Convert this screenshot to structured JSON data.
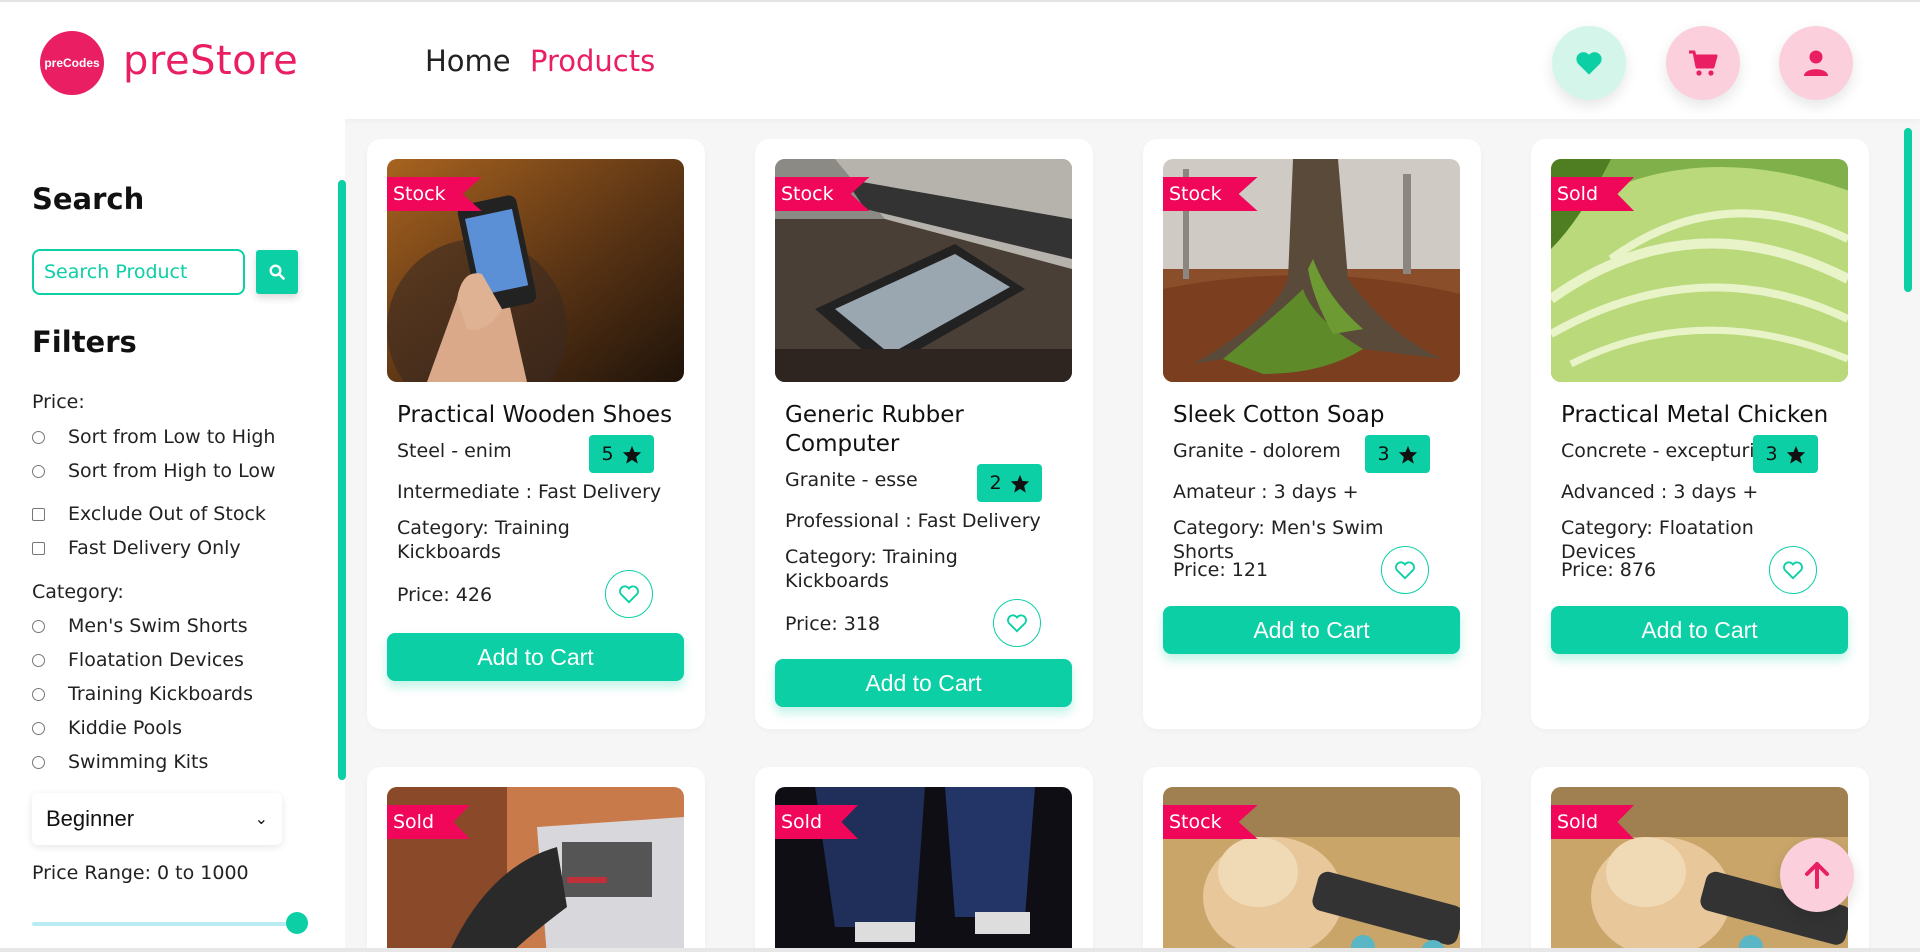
{
  "header": {
    "logo_text": "preCodes",
    "brand": "preStore",
    "nav": {
      "home": "Home",
      "products": "Products"
    },
    "icons": {
      "wishlist": "heart-icon",
      "cart": "cart-icon",
      "user": "user-icon"
    }
  },
  "sidebar": {
    "search_title": "Search",
    "search_placeholder": "Search Product",
    "filters_title": "Filters",
    "price_label": "Price:",
    "sort_low_high": "Sort from Low to High",
    "sort_high_low": "Sort from High to Low",
    "exclude_out_of_stock": "Exclude Out of Stock",
    "fast_delivery_only": "Fast Delivery Only",
    "category_label": "Category:",
    "categories": [
      "Men's Swim Shorts",
      "Floatation Devices",
      "Training Kickboards",
      "Kiddie Pools",
      "Swimming Kits"
    ],
    "level_selected": "Beginner",
    "price_range_label": "Price Range: 0 to 1000",
    "price_range_value": 1000
  },
  "products": [
    {
      "badge": "Stock",
      "name": "Practical Wooden Shoes",
      "material": "Steel - enim",
      "rating": "5",
      "level_delivery": "Intermediate : Fast Delivery",
      "category": "Category: Training Kickboards",
      "price": "Price: 426",
      "cta": "Add to Cart"
    },
    {
      "badge": "Stock",
      "name": "Generic Rubber Computer",
      "material": "Granite - esse",
      "rating": "2",
      "level_delivery": "Professional : Fast Delivery",
      "category": "Category: Training Kickboards",
      "price": "Price: 318",
      "cta": "Add to Cart"
    },
    {
      "badge": "Stock",
      "name": "Sleek Cotton Soap",
      "material": "Granite - dolorem",
      "rating": "3",
      "level_delivery": "Amateur : 3 days +",
      "category": "Category: Men's Swim Shorts",
      "price": "Price: 121",
      "cta": "Add to Cart"
    },
    {
      "badge": "Sold",
      "name": "Practical Metal Chicken",
      "material": "Concrete - excepturi",
      "rating": "3",
      "level_delivery": "Advanced : 3 days +",
      "category": "Category: Floatation Devices",
      "price": "Price: 876",
      "cta": "Add to Cart"
    }
  ],
  "products_row2": [
    {
      "badge": "Sold"
    },
    {
      "badge": "Sold"
    },
    {
      "badge": "Stock"
    },
    {
      "badge": "Sold"
    }
  ],
  "colors": {
    "accent_teal": "#0ccfa5",
    "brand_pink": "#e91e63",
    "ribbon": "#f0075a"
  }
}
